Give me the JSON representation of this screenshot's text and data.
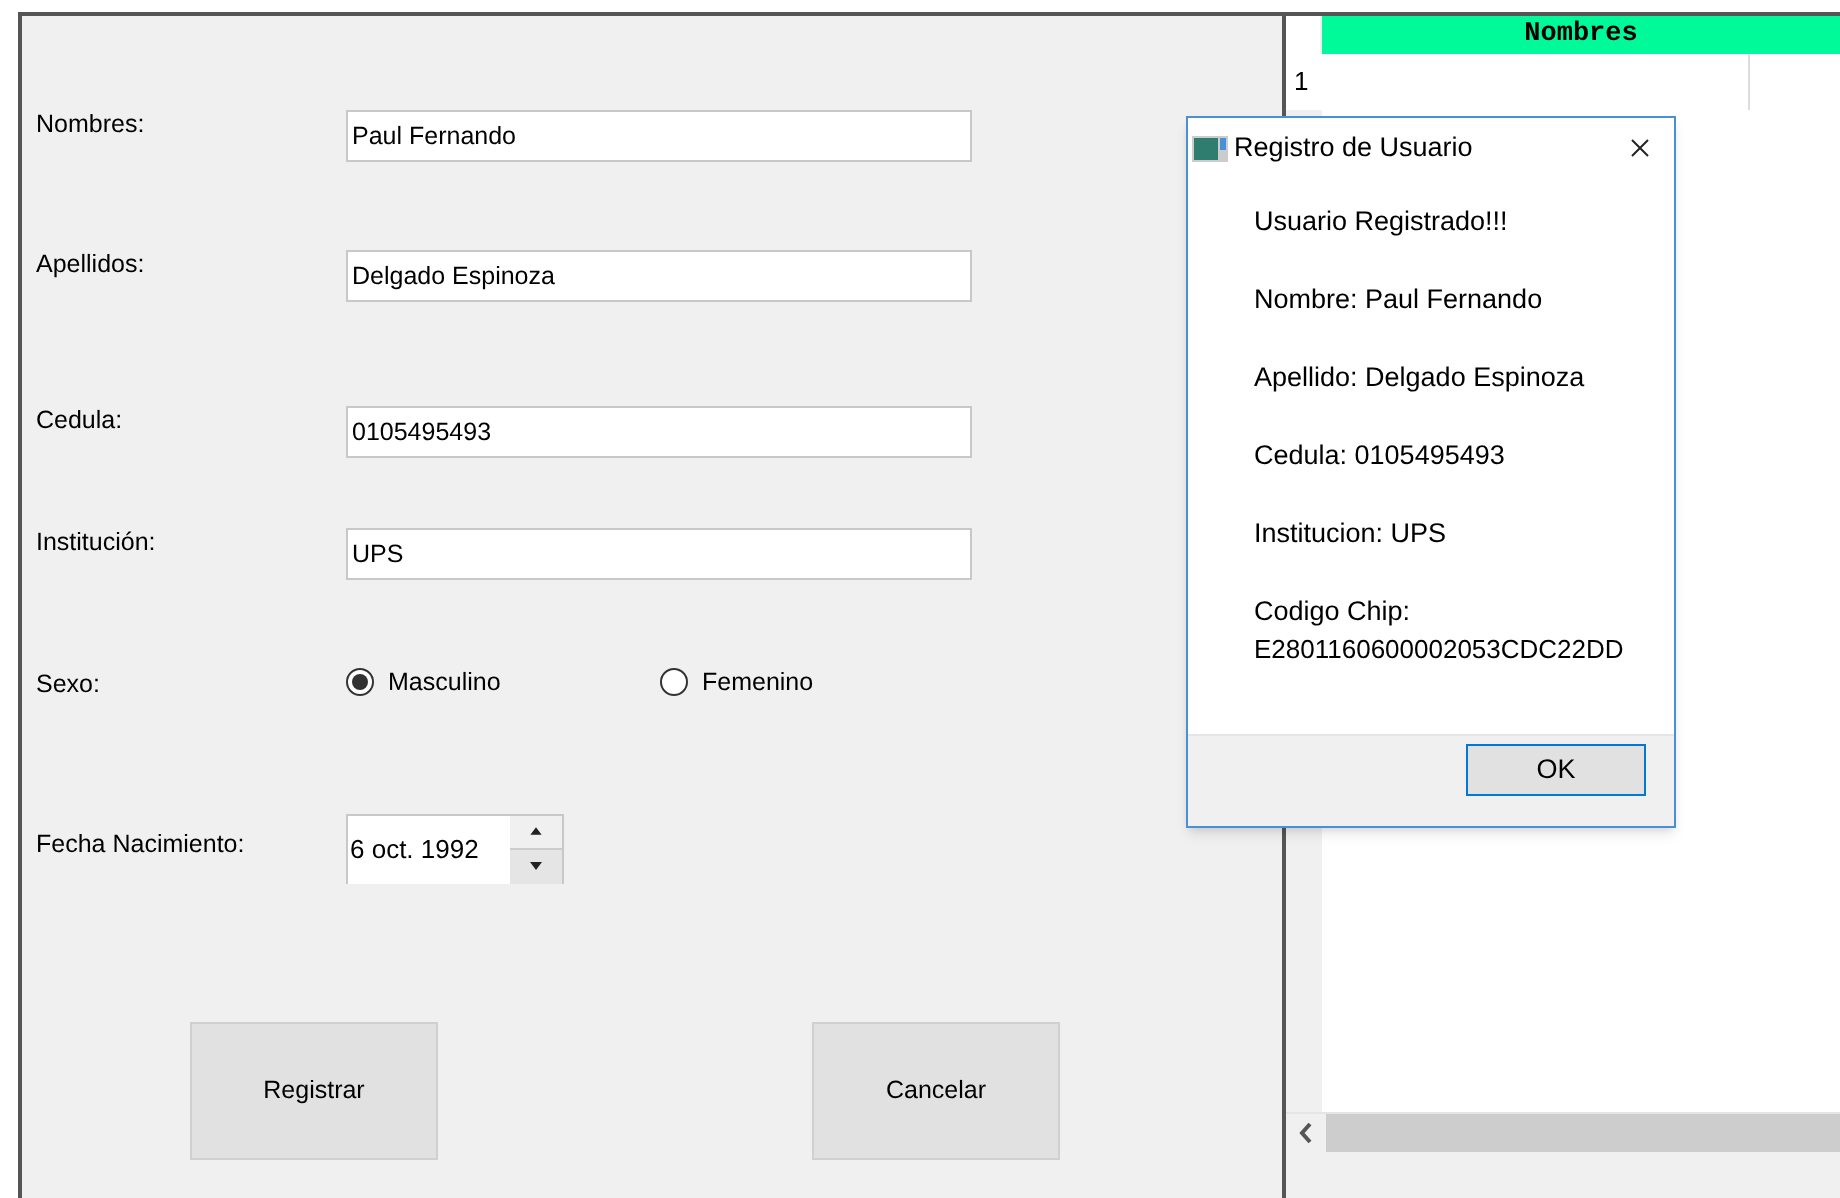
{
  "form": {
    "fields": [
      {
        "label": "Nombres:",
        "value": "Paul Fernando"
      },
      {
        "label": "Apellidos:",
        "value": "Delgado Espinoza"
      },
      {
        "label": "Cedula:",
        "value": "0105495493"
      },
      {
        "label": "Institución:",
        "value": "UPS"
      }
    ],
    "sex": {
      "label": "Sexo:",
      "options": [
        {
          "label": "Masculino",
          "selected": true
        },
        {
          "label": "Femenino",
          "selected": false
        }
      ]
    },
    "birth_date": {
      "label": "Fecha Nacimiento:",
      "value": "6 oct. 1992"
    },
    "buttons": [
      "Registrar",
      "Cancelar"
    ]
  },
  "table": {
    "columns": [
      "Nombres"
    ],
    "row_headers": [
      "1"
    ]
  },
  "dialog": {
    "title": "Registro de Usuario",
    "lines": [
      "Usuario Registrado!!!",
      "Nombre: Paul Fernando",
      "Apellido: Delgado Espinoza",
      "Cedula: 0105495493",
      "Institucion: UPS"
    ],
    "chip": {
      "label": "Codigo Chip:",
      "value": "E2801160600002053CDC22DD"
    },
    "button": "OK"
  }
}
